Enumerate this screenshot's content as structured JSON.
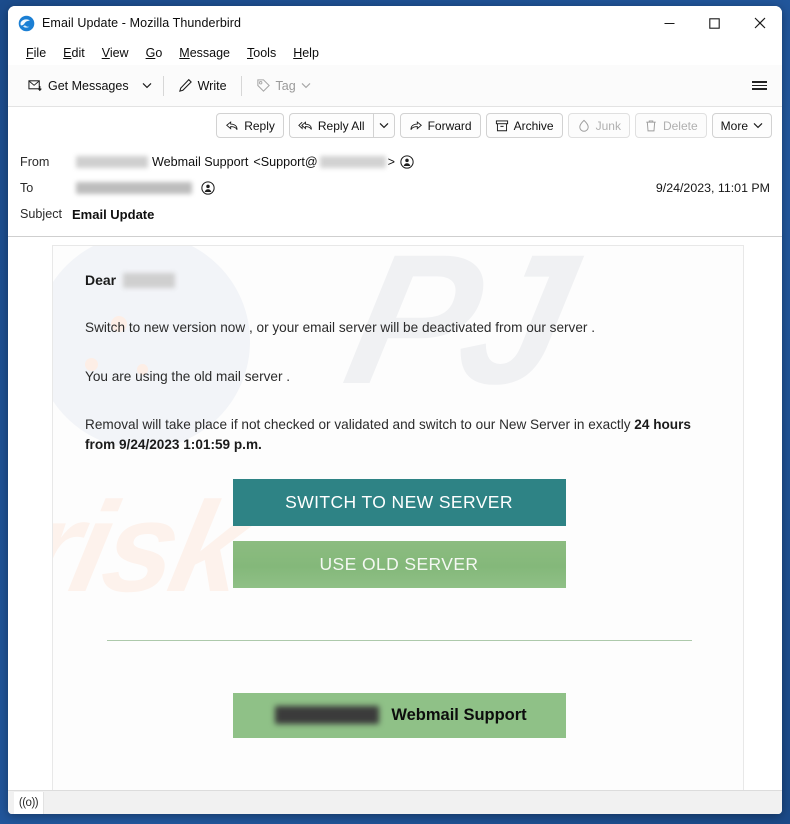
{
  "window": {
    "title": "Email Update - Mozilla Thunderbird",
    "logo_icon": "thunderbird-logo-icon",
    "controls": {
      "minimize": "minimize-icon",
      "maximize": "maximize-icon",
      "close": "close-icon"
    }
  },
  "menubar": {
    "items": [
      {
        "label": "File",
        "accel": "F",
        "rest": "ile"
      },
      {
        "label": "Edit",
        "accel": "E",
        "rest": "dit"
      },
      {
        "label": "View",
        "accel": "V",
        "rest": "iew"
      },
      {
        "label": "Go",
        "accel": "G",
        "rest": "o"
      },
      {
        "label": "Message",
        "accel": "M",
        "rest": "essage"
      },
      {
        "label": "Tools",
        "accel": "T",
        "rest": "ools"
      },
      {
        "label": "Help",
        "accel": "H",
        "rest": "elp"
      }
    ]
  },
  "toolbar": {
    "get_messages_label": "Get Messages",
    "get_messages_icon": "envelope-download-icon",
    "get_messages_chevron": "chevron-down-icon",
    "write_label": "Write",
    "write_icon": "pencil-icon",
    "tag_label": "Tag",
    "tag_icon": "tag-icon",
    "tag_chevron": "chevron-down-icon",
    "tag_enabled": false,
    "app_menu_icon": "hamburger-menu-icon"
  },
  "message_actions": [
    {
      "label": "Reply",
      "icon": "reply-arrow-icon",
      "enabled": true
    },
    {
      "label": "Reply All",
      "icon": "reply-all-arrow-icon",
      "enabled": true
    },
    {
      "label": "Forward",
      "icon": "forward-arrow-icon",
      "enabled": true
    },
    {
      "label": "Archive",
      "icon": "archive-box-icon",
      "enabled": true
    },
    {
      "label": "Junk",
      "icon": "junk-flame-icon",
      "enabled": false
    },
    {
      "label": "Delete",
      "icon": "trash-icon",
      "enabled": false
    },
    {
      "label": "More",
      "icon": "chevron-down-icon",
      "enabled": true
    }
  ],
  "message_actions_reply_all_chevron": "chevron-down-icon",
  "headers": {
    "from_label": "From",
    "from_sender_redacted": true,
    "from_name": "Webmail Support",
    "from_address_prefix": "<Support@",
    "from_address_suffix": ">",
    "from_contact_icon": "contact-circle-icon",
    "to_label": "To",
    "to_redacted": true,
    "to_contact_icon": "contact-circle-icon",
    "date": "9/24/2023, 11:01 PM",
    "subject_label": "Subject",
    "subject_value": "Email Update"
  },
  "body": {
    "greeting": "Dear",
    "greeting_name_redacted": true,
    "paragraph1": "Switch to new version now  , or your email server will be deactivated from our server .",
    "paragraph2": "You  are using the old  mail server .",
    "paragraph3_lead": "Removal will take place if not checked or validated and switch to our New Server in exactly ",
    "paragraph3_bold": "24 hours from 9/24/2023 1:01:59 p.m.",
    "button_primary": "SWITCH TO NEW SERVER",
    "button_secondary": "USE OLD SERVER",
    "signature_redacted": true,
    "signature_text": "Webmail Support",
    "watermark_top": "PJ",
    "watermark_bottom": "risk"
  },
  "statusbar": {
    "indicator_icon": "broadcast-signal-icon",
    "indicator_glyph": "((o))"
  },
  "colors": {
    "primary_button": "#2e8385",
    "secondary_button": "#84b87a",
    "signature_bg": "#8fc187",
    "divider": "#adc9ab",
    "desktop": "#1d4e8f"
  }
}
